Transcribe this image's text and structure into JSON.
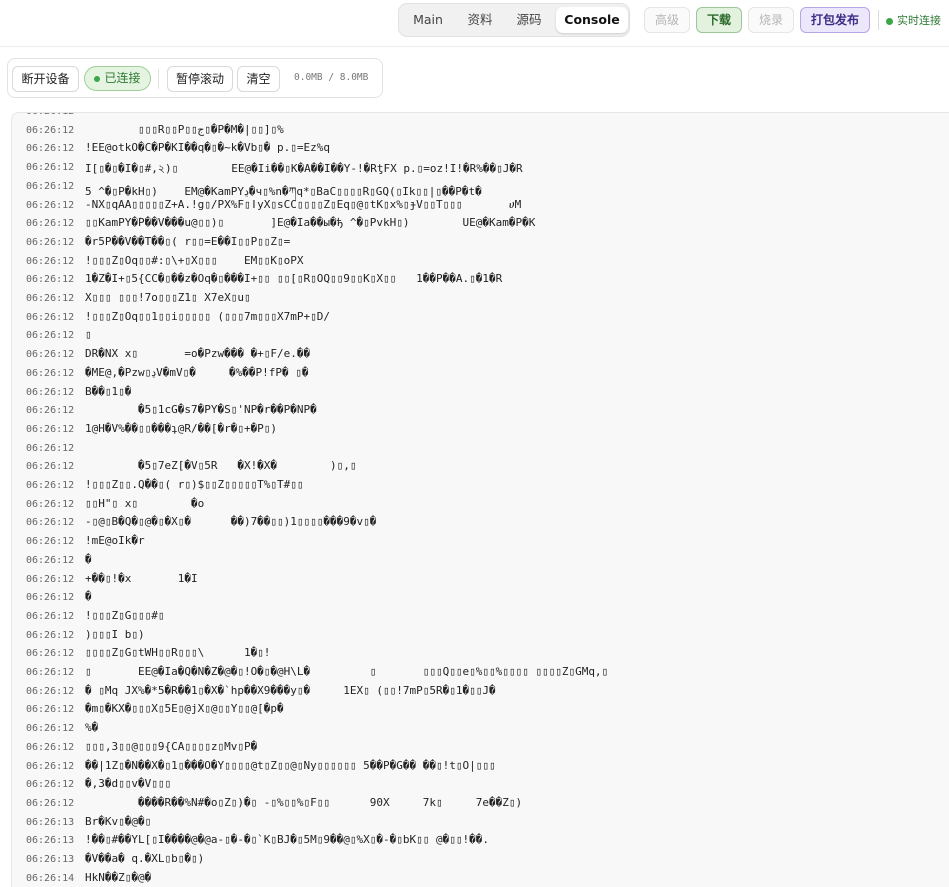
{
  "header": {
    "tabs": [
      {
        "label": "Main",
        "active": false
      },
      {
        "label": "资料",
        "active": false
      },
      {
        "label": "源码",
        "active": false
      },
      {
        "label": "Console",
        "active": true
      }
    ],
    "actions": {
      "advanced": "高级",
      "download": "下载",
      "flash": "烧录",
      "package_publish": "打包发布"
    },
    "live_status": "实时连接"
  },
  "toolbar": {
    "disconnect": "断开设备",
    "connected": "已连接",
    "pause_scroll": "暂停滚动",
    "clear": "清空",
    "memory": "0.0MB / 8.0MB"
  },
  "colors": {
    "accent_green": "#3aa64a",
    "purple_button": "#ede7fb",
    "console_bg": "#f8f8f8"
  },
  "log": [
    {
      "time": "06:26:12",
      "text": ""
    },
    {
      "time": "06:26:12",
      "text": "        ▯▯▯R▯▯P▯▯ج▯�P�M�|▯▯]▯%"
    },
    {
      "time": "06:26:12",
      "text": "!EE@otkO�C�P�KI��q�▯�~k�Vb▯� p.▯=Ez%q"
    },
    {
      "time": "06:26:12",
      "text": "I[▯�▯�I�▯#,২)▯        EE@�Ii��▯K�A��I��Y-!�RƫFX p.▯=oz!I!�R%��▯J�R"
    },
    {
      "time": "06:26:12",
      "text": "5 ^�▯P�kH▯)    EM@�KamPYڍ�ч▯%n�ཀq*▯BaC▯▯▯▯R▯GQ(▯Ik▯▯|▯��P�t�"
    },
    {
      "time": "06:26:12",
      "text": "-NX▯qAA▯▯▯▯▯Z+A.!g▯/PX%F▯ǀyX▯sCC▯▯▯▯Z▯Eq▯@▯tK▯x%▯ɟV▯▯T▯▯▯       ሀM"
    },
    {
      "time": "06:26:12",
      "text": "▯▯KamPY�ؘP��V���u@▯▯)▯       ]E@�Ia��ы�ђ ^�▯PvkH▯)        UE@�Kam�P�K"
    },
    {
      "time": "06:26:12",
      "text": "�r5P��V��T��▯( r▯▯=E��I▯▯P▯▯Z▯="
    },
    {
      "time": "06:26:12",
      "text": "!▯▯▯Z▯Oq▯▯#:▯\\+▯X▯▯▯    EM▯▯K▯oPX"
    },
    {
      "time": "06:26:12",
      "text": "1�Z�I+▯5{CC�▯��z�Oq�▯���I+▯▯ ▯▯[▯R▯OQ▯▯9▯▯K▯X▯▯   1��P��A.▯�1�R"
    },
    {
      "time": "06:26:12",
      "text": "X▯▯▯ ▯▯▯!7o▯▯▯Z1▯ X7eX▯u▯"
    },
    {
      "time": "06:26:12",
      "text": "!▯▯▯Z▯Oq▯▯1▯▯i▯▯▯▯▯ (▯▯▯7m▯▯▯X7mP+▯D/"
    },
    {
      "time": "06:26:12",
      "text": "▯"
    },
    {
      "time": "06:26:12",
      "text": "DR�NX x▯       =o�Pzw��� �+▯F/e.��"
    },
    {
      "time": "06:26:12",
      "text": "�ME@,�Pzw▯ڍV�mV▯�     �%��P!fP� ▯�"
    },
    {
      "time": "06:26:12",
      "text": "B��▯1▯�"
    },
    {
      "time": "06:26:12",
      "text": "        �5▯1cG�s7�PY�S▯'NP�r��P�NP�"
    },
    {
      "time": "06:26:12",
      "text": "1@H�V%��▯▯���ʇ@R/��[�r�▯+�P▯)"
    },
    {
      "time": "06:26:12",
      "text": ""
    },
    {
      "time": "06:26:12",
      "text": "        �5▯7eZ[�V▯5R   �X!�X�        )▯,▯"
    },
    {
      "time": "06:26:12",
      "text": "!▯▯▯Z▯▯.Q��▯( r▯)$▯▯Z▯▯▯▯▯T%▯T#▯▯"
    },
    {
      "time": "06:26:12",
      "text": "▯▯H\"▯ x▯        �o"
    },
    {
      "time": "06:26:12",
      "text": "-▯@▯B�Q�▯@�▯�X▯�      ��)7��▯▯)1▯▯▯▯���9�v▯�"
    },
    {
      "time": "06:26:12",
      "text": "!mE@oIk�r"
    },
    {
      "time": "06:26:12",
      "text": "�"
    },
    {
      "time": "06:26:12",
      "text": "+��▯!�x       1�I"
    },
    {
      "time": "06:26:12",
      "text": "�"
    },
    {
      "time": "06:26:12",
      "text": "!▯▯▯Z▯G▯▯▯#▯"
    },
    {
      "time": "06:26:12",
      "text": ")▯▯▯I b▯)"
    },
    {
      "time": "06:26:12",
      "text": "▯▯▯▯Z▯G▯tWH▯▯R▯▯▯\\      1�▯!"
    },
    {
      "time": "06:26:12",
      "text": "▯       EE@�Ia�Q�N�Z�@�▯!O�▯�@H\\L�         ▯       ▯▯▯Q▯▯e▯%▯▯%▯▯▯▯ ▯▯▯▯Z▯GMq,▯"
    },
    {
      "time": "06:26:12",
      "text": "� ▯Mq JX%�*5�R��1▯�X�`hp��X9���y▯�     1EX▯ (▯▯!7mP▯5R�▯1�▯▯J�"
    },
    {
      "time": "06:26:12",
      "text": "�m▯�KX�▯▯▯X▯5E▯@jX▯@▯▯Y▯▯@[�p�"
    },
    {
      "time": "06:26:12",
      "text": "%�"
    },
    {
      "time": "06:26:12",
      "text": "▯▯▯,3▯▯@▯▯▯9{CA▯▯▯▯z▯Mv▯P�"
    },
    {
      "time": "06:26:12",
      "text": "��|1Z▯�N��X�▯1▯���O�Y▯▯▯▯@t▯Z▯▯@▯Ny▯▯▯▯▯▯ 5��P�G�� ��▯!t▯O|▯▯▯"
    },
    {
      "time": "06:26:12",
      "text": "�,3�d▯▯v�V▯▯▯"
    },
    {
      "time": "06:26:12",
      "text": "        ����R��%N#�o▯Z▯)�▯ -▯%▯▯%▯F▯▯      90X     7k▯     7e��Z▯)"
    },
    {
      "time": "06:26:13",
      "text": "Br�Kv▯�@�▯"
    },
    {
      "time": "06:26:13",
      "text": "!��▯#��YL[▯I����@�@a-▯�-�▯`K▯BJ�▯5M▯9��@▯%X▯�-�▯bK▯▯ @�▯▯!��."
    },
    {
      "time": "06:26:13",
      "text": "�V��a� q.�XL▯b▯�▯)"
    },
    {
      "time": "06:26:14",
      "text": "HkN��Z▯�@�"
    }
  ]
}
